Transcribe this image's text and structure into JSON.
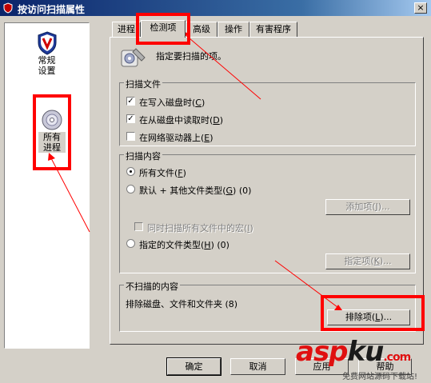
{
  "window": {
    "title": "按访问扫描属性",
    "close_label": "×"
  },
  "left_nav": [
    {
      "label_line1": "常规",
      "label_line2": "设置"
    },
    {
      "label_line1": "所有",
      "label_line2": "进程"
    }
  ],
  "tabs": [
    "进程",
    "检测项",
    "高级",
    "操作",
    "有害程序"
  ],
  "header_text": "指定要扫描的项。",
  "scan_files": {
    "title": "扫描文件",
    "options": [
      {
        "label": "在写入磁盘时",
        "accel": "C",
        "checked": true
      },
      {
        "label": "在从磁盘中读取时",
        "accel": "D",
        "checked": true
      },
      {
        "label": "在网络驱动器上",
        "accel": "E",
        "checked": false
      }
    ]
  },
  "scan_content": {
    "title": "扫描内容",
    "all_files": {
      "label": "所有文件",
      "accel": "F"
    },
    "default_types": {
      "label": "默认 + 其他文件类型",
      "accel": "G",
      "count": "(0)"
    },
    "add_button": {
      "label": "添加项",
      "accel": "J",
      "suffix": "..."
    },
    "macros_checkbox": {
      "label": "同时扫描所有文件中的宏",
      "accel": "I"
    },
    "specified_types": {
      "label": "指定的文件类型",
      "accel": "H",
      "count": "(0)"
    },
    "specify_button": {
      "label": "指定项",
      "accel": "K",
      "suffix": "..."
    }
  },
  "exclusions": {
    "title": "不扫描的内容",
    "text": "排除磁盘、文件和文件夹 (8)",
    "button": {
      "label": "排除项",
      "accel": "L",
      "suffix": "..."
    }
  },
  "bottom_buttons": {
    "ok": "确定",
    "cancel": "取消",
    "apply": "应用",
    "help": "帮助"
  },
  "watermark": {
    "brand": "asp",
    "brand_accent": "ku",
    "suffix": ".com",
    "tagline": "免费网站源码下载站!"
  },
  "colors": {
    "annotation_red": "#ff0000",
    "title_blue": "#0a246a",
    "dialog_gray": "#d4d0c8"
  }
}
